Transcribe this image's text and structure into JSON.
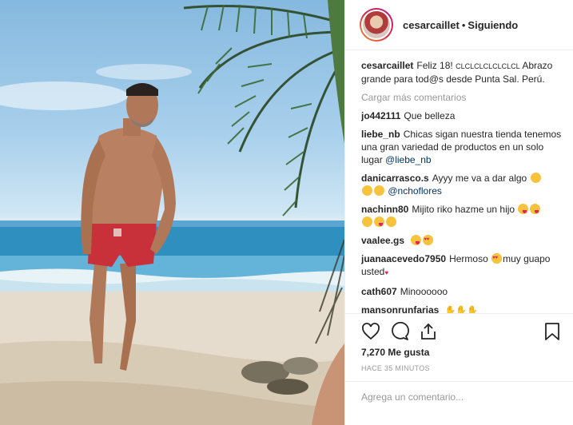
{
  "post": {
    "username": "cesarcaillet",
    "separator": "•",
    "follow_status": "Siguiendo"
  },
  "caption": {
    "username": "cesarcaillet",
    "text_a": "Feliz 18!",
    "text_b": "CLCLCLCLCLCLCL",
    "text_c": "Abrazo grande para tod@s desde Punta Sal. Perú."
  },
  "load_more": "Cargar más comentarios",
  "comments": [
    {
      "user": "jo442111",
      "text": "Que belleza"
    },
    {
      "user": "liebe_nb",
      "text": "Chicas sigan nuestra tienda tenemos una gran variedad de productos en un solo lugar",
      "mention": "@liebe_nb"
    },
    {
      "user": "danicarrasco.s",
      "text": "Ayyy me va a dar algo",
      "mention": "@nchoflores"
    },
    {
      "user": "nachinn80",
      "text": "Mijito riko hazme un hijo"
    },
    {
      "user": "vaalee.gs",
      "text": ""
    },
    {
      "user": "juanaacevedo7950",
      "text_a": "Hermoso",
      "text_b": "muy guapo usted"
    },
    {
      "user": "cath607",
      "text": "Minoooooo"
    },
    {
      "user": "mansonrunfarias",
      "text": ""
    }
  ],
  "actions": {
    "likes": "7,270 Me gusta",
    "time": "HACE 35 MINUTOS"
  },
  "comment_box": {
    "placeholder": "Agrega un comentario..."
  },
  "icons": {
    "like": "heart-icon",
    "comment": "comment-icon",
    "share": "share-icon",
    "save": "bookmark-icon"
  }
}
